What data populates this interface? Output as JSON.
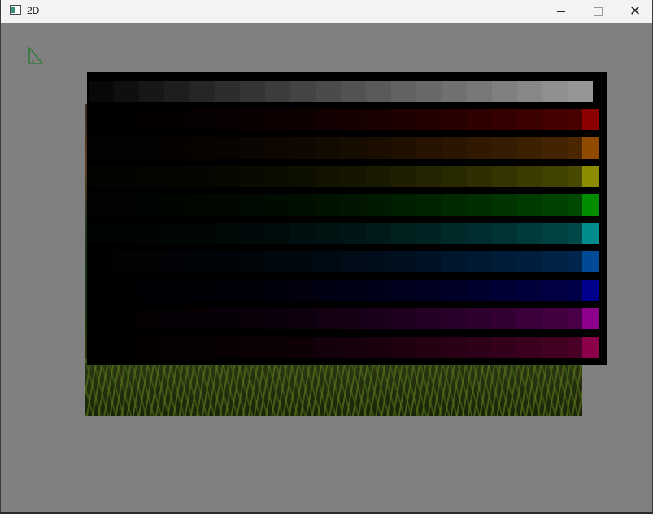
{
  "window": {
    "title": "2D",
    "controls": {
      "minimize": "minimize",
      "maximize": "maximize",
      "close": "close"
    }
  },
  "canvas": {
    "background": "#808080",
    "icon": "right-triangle-icon",
    "triangle_color": "#1f7a2a"
  },
  "palette": {
    "columns": 20,
    "rows": [
      {
        "name": "gray",
        "color": "#969696"
      },
      {
        "name": "red",
        "color": "#8c0000"
      },
      {
        "name": "orange",
        "color": "#914b00"
      },
      {
        "name": "yellow",
        "color": "#8c8c00"
      },
      {
        "name": "green",
        "color": "#008c00"
      },
      {
        "name": "cyan",
        "color": "#008c8c"
      },
      {
        "name": "blue",
        "color": "#004a96"
      },
      {
        "name": "navy",
        "color": "#00008c"
      },
      {
        "name": "purple",
        "color": "#8c008c"
      },
      {
        "name": "magenta",
        "color": "#8c004a"
      }
    ]
  }
}
